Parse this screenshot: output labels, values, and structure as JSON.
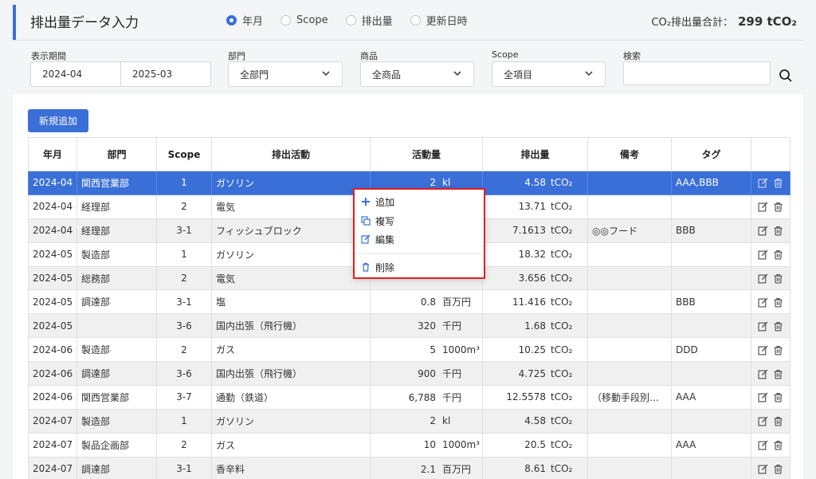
{
  "header": {
    "title": "排出量データ入力",
    "radios": [
      {
        "label": "年月",
        "selected": true
      },
      {
        "label": "Scope",
        "selected": false
      },
      {
        "label": "排出量",
        "selected": false
      },
      {
        "label": "更新日時",
        "selected": false
      }
    ],
    "total_label": "CO₂排出量合計：",
    "total_value": "299 tCO₂"
  },
  "filters": {
    "period_label": "表示期間",
    "period_from": "2024-04",
    "period_to": "2025-03",
    "dept_label": "部門",
    "dept_value": "全部門",
    "product_label": "商品",
    "product_value": "全商品",
    "scope_label": "Scope",
    "scope_value": "全項目",
    "search_label": "検索",
    "search_value": ""
  },
  "add_button": "新規追加",
  "table": {
    "headers": [
      "年月",
      "部門",
      "Scope",
      "排出活動",
      "活動量",
      "排出量",
      "備考",
      "タグ",
      ""
    ],
    "rows": [
      {
        "ym": "2024-04",
        "dept": "関西営業部",
        "scope": "1",
        "activity": "ガソリン",
        "amount": "2",
        "unit": "kl",
        "emission": "4.58",
        "eunit": "tCO₂",
        "note": "",
        "tag": "AAA,BBB",
        "selected": true
      },
      {
        "ym": "2024-04",
        "dept": "経理部",
        "scope": "2",
        "activity": "電気",
        "amount": "",
        "unit": "",
        "emission": "13.71",
        "eunit": "tCO₂",
        "note": "",
        "tag": ""
      },
      {
        "ym": "2024-04",
        "dept": "経理部",
        "scope": "3-1",
        "activity": "フィッシュブロック",
        "amount": "",
        "unit": "",
        "emission": "7.1613",
        "eunit": "tCO₂",
        "note": "◎◎フード",
        "tag": "BBB"
      },
      {
        "ym": "2024-05",
        "dept": "製造部",
        "scope": "1",
        "activity": "ガソリン",
        "amount": "",
        "unit": "",
        "emission": "18.32",
        "eunit": "tCO₂",
        "note": "",
        "tag": ""
      },
      {
        "ym": "2024-05",
        "dept": "総務部",
        "scope": "2",
        "activity": "電気",
        "amount": "",
        "unit": "",
        "emission": "3.656",
        "eunit": "tCO₂",
        "note": "",
        "tag": ""
      },
      {
        "ym": "2024-05",
        "dept": "調達部",
        "scope": "3-1",
        "activity": "塩",
        "amount": "0.8",
        "unit": "百万円",
        "emission": "11.416",
        "eunit": "tCO₂",
        "note": "",
        "tag": "BBB"
      },
      {
        "ym": "2024-05",
        "dept": "",
        "scope": "3-6",
        "activity": "国内出張（飛行機）",
        "amount": "320",
        "unit": "千円",
        "emission": "1.68",
        "eunit": "tCO₂",
        "note": "",
        "tag": ""
      },
      {
        "ym": "2024-06",
        "dept": "製造部",
        "scope": "2",
        "activity": "ガス",
        "amount": "5",
        "unit": "1000m³",
        "emission": "10.25",
        "eunit": "tCO₂",
        "note": "",
        "tag": "DDD"
      },
      {
        "ym": "2024-06",
        "dept": "調達部",
        "scope": "3-6",
        "activity": "国内出張（飛行機）",
        "amount": "900",
        "unit": "千円",
        "emission": "4.725",
        "eunit": "tCO₂",
        "note": "",
        "tag": ""
      },
      {
        "ym": "2024-06",
        "dept": "関西営業部",
        "scope": "3-7",
        "activity": "通勤（鉄道）",
        "amount": "6,788",
        "unit": "千円",
        "emission": "12.5578",
        "eunit": "tCO₂",
        "note": "（移動手段別…",
        "tag": "AAA"
      },
      {
        "ym": "2024-07",
        "dept": "製造部",
        "scope": "1",
        "activity": "ガソリン",
        "amount": "2",
        "unit": "kl",
        "emission": "4.58",
        "eunit": "tCO₂",
        "note": "",
        "tag": ""
      },
      {
        "ym": "2024-07",
        "dept": "製品企画部",
        "scope": "2",
        "activity": "ガス",
        "amount": "10",
        "unit": "1000m³",
        "emission": "20.5",
        "eunit": "tCO₂",
        "note": "",
        "tag": "AAA"
      },
      {
        "ym": "2024-07",
        "dept": "調達部",
        "scope": "3-1",
        "activity": "香辛料",
        "amount": "2.1",
        "unit": "百万円",
        "emission": "8.61",
        "eunit": "tCO₂",
        "note": "",
        "tag": ""
      }
    ]
  },
  "context_menu": {
    "add": "追加",
    "copy": "複写",
    "edit": "編集",
    "delete": "削除"
  },
  "colors": {
    "accent": "#3b6fd8",
    "menu_border": "#e02020"
  }
}
